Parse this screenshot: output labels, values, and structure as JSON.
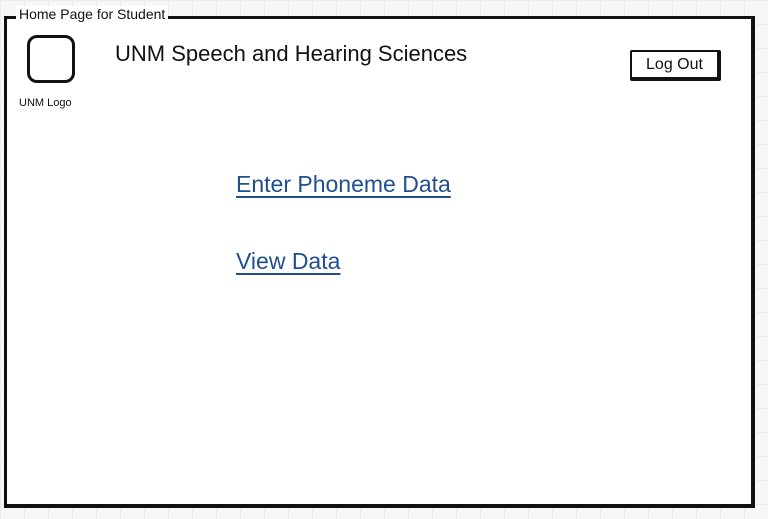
{
  "window": {
    "title": "Home Page for Student"
  },
  "header": {
    "logo_caption": "UNM Logo",
    "app_title": "UNM Speech and Hearing Sciences",
    "logout_label": "Log Out"
  },
  "links": {
    "enter_phoneme_data": "Enter Phoneme Data",
    "view_data": "View Data"
  },
  "colors": {
    "link": "#1f4f8f",
    "border": "#111111",
    "background": "#ffffff"
  }
}
